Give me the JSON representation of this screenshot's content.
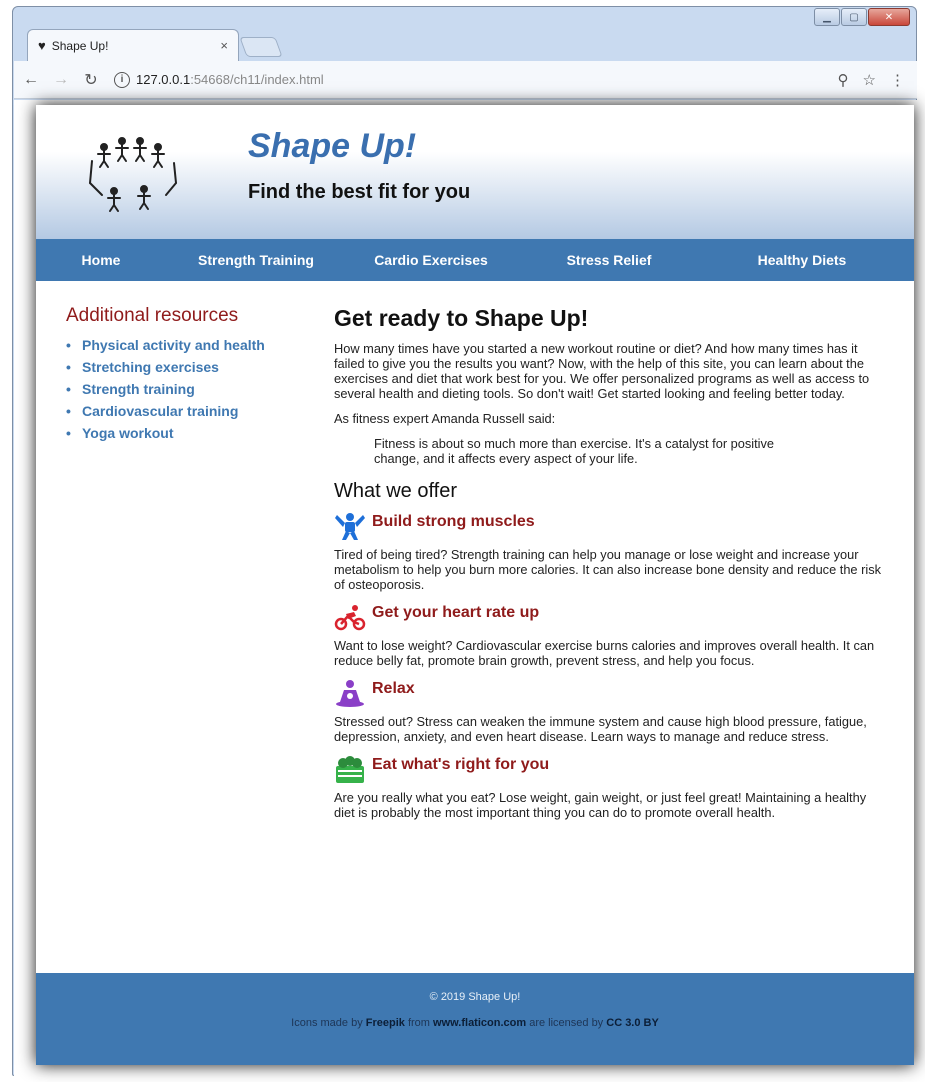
{
  "browser": {
    "tab_title": "Shape Up!",
    "tab_close": "×",
    "url_host": "127.0.0.1",
    "url_path": ":54668/ch11/index.html"
  },
  "site": {
    "title": "Shape Up!",
    "tagline": "Find the best fit for you",
    "nav": [
      {
        "label": "Home"
      },
      {
        "label": "Strength Training"
      },
      {
        "label": "Cardio Exercises"
      },
      {
        "label": "Stress Relief"
      },
      {
        "label": "Healthy Diets"
      }
    ],
    "sidebar": {
      "heading": "Additional resources",
      "links": [
        {
          "label": "Physical activity and health"
        },
        {
          "label": "Stretching exercises"
        },
        {
          "label": "Strength training"
        },
        {
          "label": "Cardiovascular training"
        },
        {
          "label": "Yoga workout"
        }
      ]
    },
    "main": {
      "heading": "Get ready to Shape Up!",
      "intro": "How many times have you started a new workout routine or diet? And how many times has it failed to give you the results you want? Now, with the help of this site, you can learn about the exercises and diet that work best for you. We offer personalized programs as well as access to several health and dieting tools. So don't wait! Get started looking and feeling better today.",
      "quote_intro": "As fitness expert Amanda Russell said:",
      "quote": "Fitness is about so much more than exercise. It's a catalyst for positive change, and it affects every aspect of your life.",
      "offer_heading": "What we offer",
      "offers": [
        {
          "title": "Build strong muscles",
          "icon": "muscle-icon",
          "color": "#1e6fd8",
          "text": "Tired of being tired? Strength training can help you manage or lose weight and increase your metabolism to help you burn more calories. It can also increase bone density and reduce the risk of osteoporosis."
        },
        {
          "title": "Get your heart rate up",
          "icon": "cyclist-icon",
          "color": "#d9232e",
          "text": "Want to lose weight? Cardiovascular exercise burns calories and improves overall health. It can reduce belly fat, promote brain growth, prevent stress, and help you focus."
        },
        {
          "title": "Relax",
          "icon": "meditation-icon",
          "color": "#8a3fc7",
          "text": "Stressed out? Stress can weaken the immune system and cause high blood pressure, fatigue, depression, anxiety, and even heart disease. Learn ways to manage and reduce stress."
        },
        {
          "title": "Eat what's right for you",
          "icon": "healthy-food-icon",
          "color": "#36b24a",
          "text": "Are you really what you eat? Lose weight, gain weight, or just feel great! Maintaining a healthy diet is probably the most important thing you can do to promote overall health."
        }
      ]
    },
    "footer": {
      "copyright": "© 2019 Shape Up!",
      "credit_pre": "Icons made by ",
      "credit_author": "Freepik",
      "credit_mid": " from ",
      "credit_site": "www.flaticon.com",
      "credit_post": " are licensed by ",
      "credit_license": "CC 3.0 BY"
    },
    "colors": {
      "nav_bg": "#3f78b1",
      "accent_red": "#8f1b1b",
      "link_blue": "#3f78b1"
    }
  }
}
